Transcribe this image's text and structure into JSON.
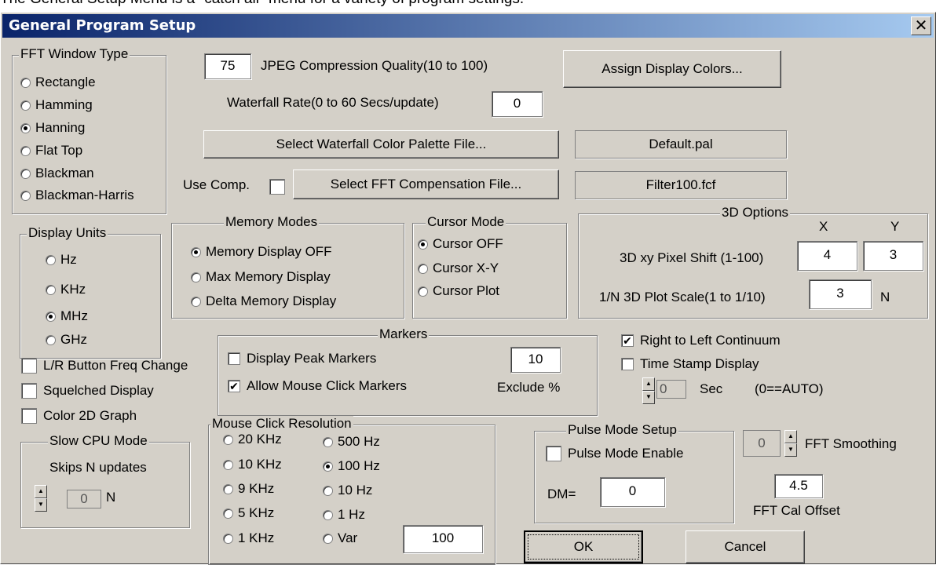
{
  "caption": "The General Setup Menu is a \"catch all\" menu for a variety of program settings.",
  "dialog": {
    "title": "General Program Setup",
    "close_glyph": "✕"
  },
  "fft_window": {
    "label": "FFT Window Type",
    "options": [
      "Rectangle",
      "Hamming",
      "Hanning",
      "Flat Top",
      "Blackman",
      "Blackman-Harris"
    ],
    "selected": "Hanning"
  },
  "jpeg": {
    "value": "75",
    "label": "JPEG Compression Quality(10 to 100)"
  },
  "waterfall_rate": {
    "label": "Waterfall Rate(0 to 60 Secs/update)",
    "value": "0"
  },
  "assign_colors": "Assign Display Colors...",
  "palette": {
    "button": "Select Waterfall Color Palette File...",
    "file": "Default.pal"
  },
  "compensation": {
    "use_label": "Use Comp.",
    "checked": false,
    "button": "Select FFT Compensation File...",
    "file": "Filter100.fcf"
  },
  "display_units": {
    "label": "Display Units",
    "options": [
      "Hz",
      "KHz",
      "MHz",
      "GHz"
    ],
    "selected": "MHz"
  },
  "memory_modes": {
    "label": "Memory Modes",
    "options": [
      "Memory Display OFF",
      "Max Memory Display",
      "Delta Memory Display"
    ],
    "selected": "Memory Display OFF"
  },
  "cursor_mode": {
    "label": "Cursor Mode",
    "options": [
      "Cursor OFF",
      "Cursor X-Y",
      "Cursor Plot"
    ],
    "selected": "Cursor OFF"
  },
  "options3d": {
    "label": "3D Options",
    "x_label": "X",
    "y_label": "Y",
    "shift_label": "3D xy Pixel Shift (1-100)",
    "shift_x": "4",
    "shift_y": "3",
    "scale_label": "1/N 3D Plot Scale(1 to 1/10)",
    "scale_value": "3",
    "scale_unit": "N"
  },
  "markers": {
    "label": "Markers",
    "display_peak": "Display Peak Markers",
    "display_peak_checked": false,
    "allow_mouse": "Allow Mouse Click Markers",
    "allow_mouse_checked": true,
    "value": "10",
    "exclude_label": "Exclude %"
  },
  "right_left": {
    "label": "Right to Left Continuum",
    "checked": true
  },
  "time_stamp": {
    "label": "Time Stamp Display",
    "checked": false,
    "value": "0",
    "sec_label": "Sec",
    "auto_label": "(0==AUTO)"
  },
  "lr_button": {
    "label": "L/R Button Freq Change",
    "checked": false
  },
  "squelched": {
    "label": "Squelched Display",
    "checked": false
  },
  "color2d": {
    "label": "Color 2D Graph",
    "checked": false
  },
  "slow_cpu": {
    "label": "Slow CPU Mode",
    "skips_label": "Skips N updates",
    "value": "0",
    "unit": "N"
  },
  "mouse_res": {
    "label": "Mouse Click Resolution",
    "col1": [
      "20 KHz",
      "10 KHz",
      "9 KHz",
      "5 KHz",
      "1 KHz"
    ],
    "col2": [
      "500 Hz",
      "100 Hz",
      "10 Hz",
      "1 Hz",
      "Var"
    ],
    "selected": "100 Hz",
    "var_value": "100"
  },
  "pulse": {
    "label": "Pulse Mode Setup",
    "enable_label": "Pulse Mode Enable",
    "checked": false,
    "dm_label": "DM=",
    "dm_value": "0"
  },
  "fft_smoothing": {
    "value": "0",
    "label": "FFT Smoothing"
  },
  "fft_cal": {
    "value": "4.5",
    "label": "FFT Cal Offset"
  },
  "ok": "OK",
  "cancel": "Cancel"
}
